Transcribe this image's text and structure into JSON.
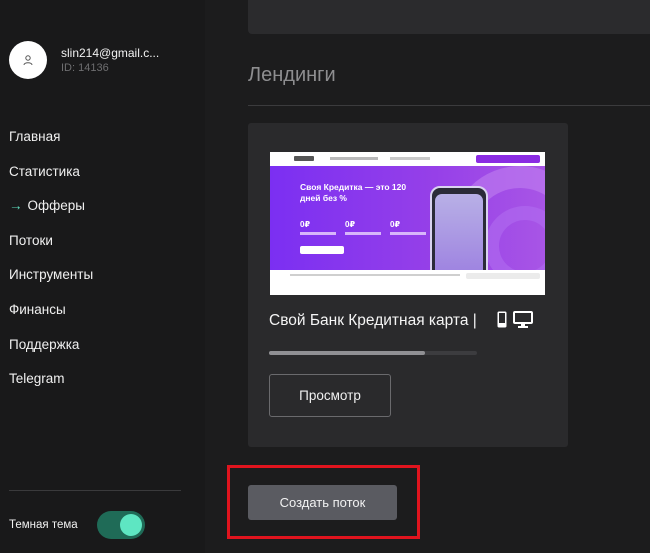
{
  "user": {
    "email": "slin214@gmail.c...",
    "id_label": "ID: 14136"
  },
  "nav": {
    "items": [
      {
        "label": "Главная"
      },
      {
        "label": "Статистика"
      },
      {
        "label": "Офферы",
        "active": true
      },
      {
        "label": "Потоки"
      },
      {
        "label": "Инструменты"
      },
      {
        "label": "Финансы"
      },
      {
        "label": "Поддержка"
      },
      {
        "label": "Telegram"
      }
    ],
    "active_marker": "→"
  },
  "theme": {
    "label": "Темная тема",
    "enabled": true
  },
  "main": {
    "section_title": "Лендинги",
    "landing": {
      "name": "Свой Банк Кредитная карта |",
      "preview": {
        "headline": "Своя Кредитка — это 120 дней без %",
        "stats": [
          "0₽",
          "0₽",
          "0₽"
        ]
      },
      "devices": [
        "mobile-icon",
        "desktop-icon"
      ],
      "progress_fraction": 0.75,
      "view_button": "Просмотр"
    },
    "create_button": "Создать поток"
  },
  "colors": {
    "accent": "#5ee6c2",
    "highlight": "#e0141e",
    "preview_purple": "#8a2be2"
  }
}
